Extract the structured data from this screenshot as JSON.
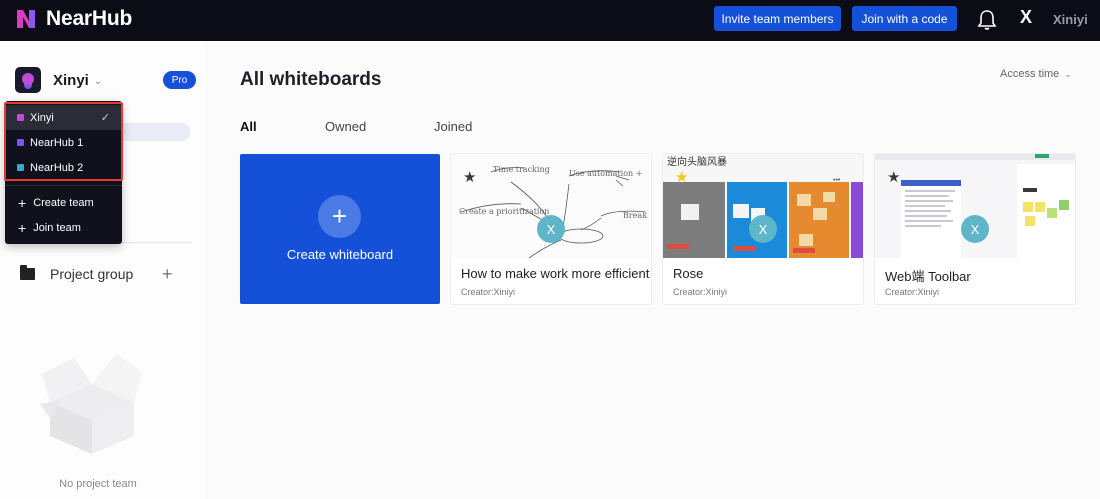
{
  "app": {
    "brand": "NearHub",
    "brand_color": "#1550d8"
  },
  "topbar": {
    "invite_button": "Invite team members",
    "join_code_button": "Join with a code",
    "notification_icon": "bell-icon",
    "avatar_initial": "X",
    "username": "Xiniyi"
  },
  "sidebar": {
    "team_name": "Xinyi",
    "pro_badge": "Pro",
    "project_group_label": "Project group",
    "empty_text": "No project team"
  },
  "team_dropdown": {
    "teams": [
      {
        "name": "Xinyi",
        "color": "#c34ad6",
        "selected": true
      },
      {
        "name": "NearHub 1",
        "color": "#7a56e8",
        "selected": false
      },
      {
        "name": "NearHub 2",
        "color": "#38a8c4",
        "selected": false
      }
    ],
    "create_team": "Create team",
    "join_team": "Join team"
  },
  "main": {
    "title": "All whiteboards",
    "sort_label": "Access time",
    "tabs": [
      {
        "label": "All",
        "active": true
      },
      {
        "label": "Owned",
        "active": false
      },
      {
        "label": "Joined",
        "active": false
      }
    ],
    "create_card_label": "Create whiteboard",
    "whiteboards": [
      {
        "title": "How to make work more efficient",
        "creator": "Creator:Xiniyi",
        "starred": false,
        "avatar": "X"
      },
      {
        "title": "Rose",
        "creator": "Creator:Xiniyi",
        "starred": true,
        "avatar": "X"
      },
      {
        "title": "Web端 Toolbar",
        "creator": "Creator:Xiniyi",
        "starred": false,
        "avatar": "X"
      }
    ]
  }
}
